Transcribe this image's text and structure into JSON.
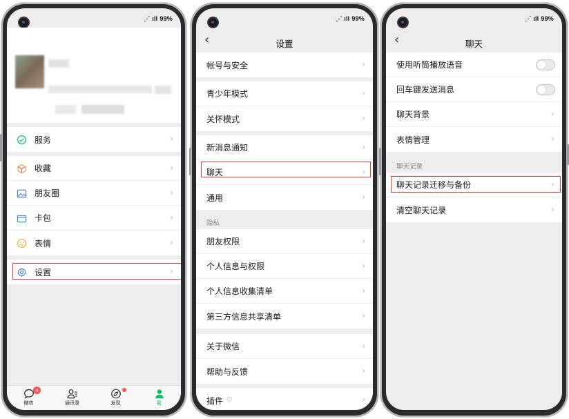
{
  "status": {
    "battery": "99%"
  },
  "screen1": {
    "menu": [
      {
        "label": "服务",
        "icon": "service-icon"
      },
      {
        "label": "收藏",
        "icon": "favorites-icon"
      },
      {
        "label": "朋友圈",
        "icon": "moments-icon"
      },
      {
        "label": "卡包",
        "icon": "card-wallet-icon"
      },
      {
        "label": "表情",
        "icon": "sticker-icon"
      },
      {
        "label": "设置",
        "icon": "settings-icon"
      }
    ],
    "tabs": [
      {
        "label": "微信",
        "badge": "4"
      },
      {
        "label": "通讯录"
      },
      {
        "label": "发现"
      },
      {
        "label": "我"
      }
    ]
  },
  "screen2": {
    "title": "设置",
    "items": [
      "帐号与安全",
      "青少年模式",
      "关怀模式",
      "新消息通知",
      "聊天",
      "通用",
      "朋友权限",
      "个人信息与权限",
      "个人信息收集清单",
      "第三方信息共享清单",
      "关于微信",
      "帮助与反馈",
      "插件"
    ],
    "privacy_header": "隐私"
  },
  "screen3": {
    "title": "聊天",
    "items": [
      "使用听筒播放语音",
      "回车键发送消息",
      "聊天背景",
      "表情管理",
      "聊天记录迁移与备份",
      "清空聊天记录"
    ],
    "history_header": "聊天记录"
  },
  "colors": {
    "accent": "#07c160",
    "highlight": "#e13a3a",
    "badge": "#fa5151"
  }
}
